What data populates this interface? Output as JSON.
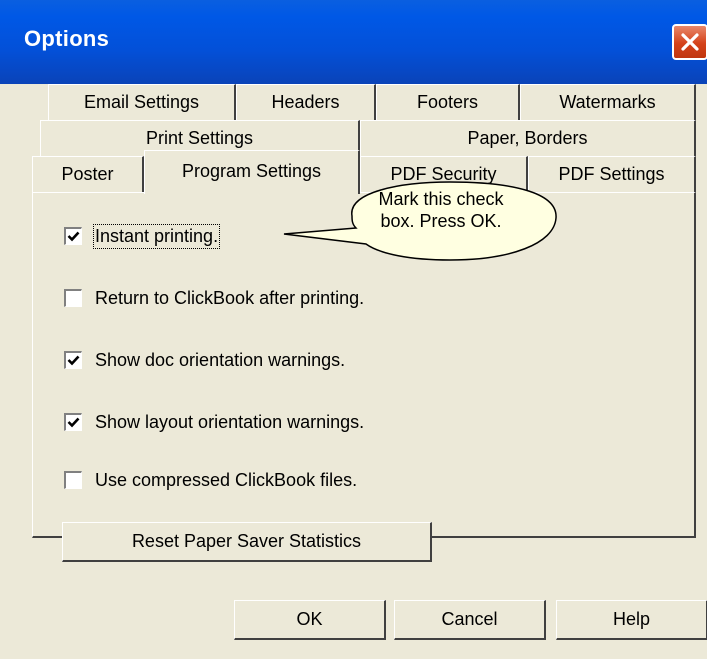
{
  "window": {
    "title": "Options"
  },
  "tabs": {
    "row1": [
      "Email Settings",
      "Headers",
      "Footers",
      "Watermarks"
    ],
    "row2": [
      "Print Settings",
      "Paper, Borders"
    ],
    "row3": [
      "Poster",
      "Program Settings",
      "PDF Security",
      "PDF Settings"
    ],
    "active": "Program Settings"
  },
  "callout": {
    "line1": "Mark this check",
    "line2": "box. Press OK."
  },
  "options": [
    {
      "label": "Instant printing.",
      "checked": true
    },
    {
      "label": "Return to ClickBook after printing.",
      "checked": false
    },
    {
      "label": "Show doc orientation warnings.",
      "checked": true
    },
    {
      "label": "Show layout orientation warnings.",
      "checked": true
    },
    {
      "label": "Use compressed ClickBook files.",
      "checked": false
    }
  ],
  "reset_button": "Reset Paper Saver Statistics",
  "buttons": {
    "ok": "OK",
    "cancel": "Cancel",
    "help": "Help"
  }
}
